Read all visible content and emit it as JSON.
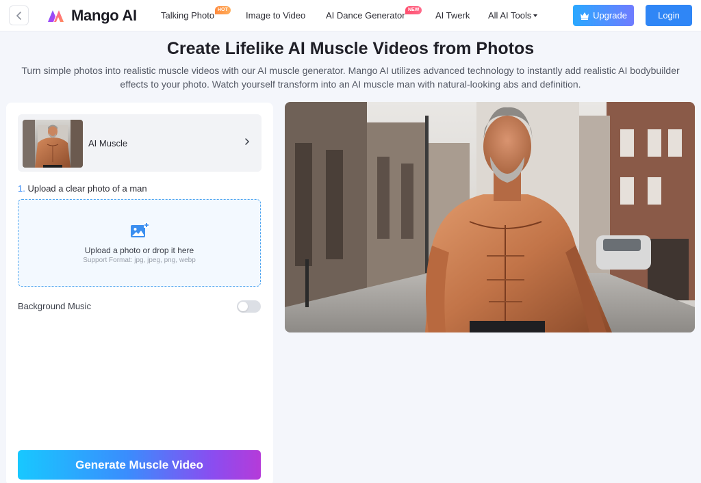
{
  "header": {
    "logo_text": "Mango AI",
    "nav": [
      {
        "label": "Talking Photo",
        "badge": "HOT"
      },
      {
        "label": "Image to Video"
      },
      {
        "label": "AI Dance Generator",
        "badge": "NEW"
      },
      {
        "label": "AI Twerk"
      },
      {
        "label": "All AI Tools"
      }
    ],
    "upgrade_label": "Upgrade",
    "login_label": "Login"
  },
  "hero": {
    "title": "Create Lifelike AI Muscle Videos from Photos",
    "subtitle": "Turn simple photos into realistic muscle videos with our AI muscle generator. Mango AI utilizes advanced technology to instantly add realistic AI bodybuilder effects to your photo. Watch yourself transform into an AI muscle man with natural-looking abs and definition."
  },
  "panel": {
    "template_name": "AI Muscle",
    "step_number": "1.",
    "step_text": "Upload a clear photo of a man",
    "upload_text": "Upload a photo or drop it here",
    "upload_formats": "Support Format: jpg, jpeg, png, webp",
    "music_label": "Background Music",
    "music_enabled": false,
    "generate_label": "Generate Muscle Video"
  },
  "icons": {
    "back": "chevron-left-icon",
    "upgrade": "crown-icon",
    "template_arrow": "chevron-right-icon",
    "upload": "image-plus-icon"
  },
  "colors": {
    "primary": "#2f86f6",
    "upload_border": "#4aa3f0",
    "hot_badge": "#ff8a3d",
    "new_badge": "#ff4d6d"
  }
}
